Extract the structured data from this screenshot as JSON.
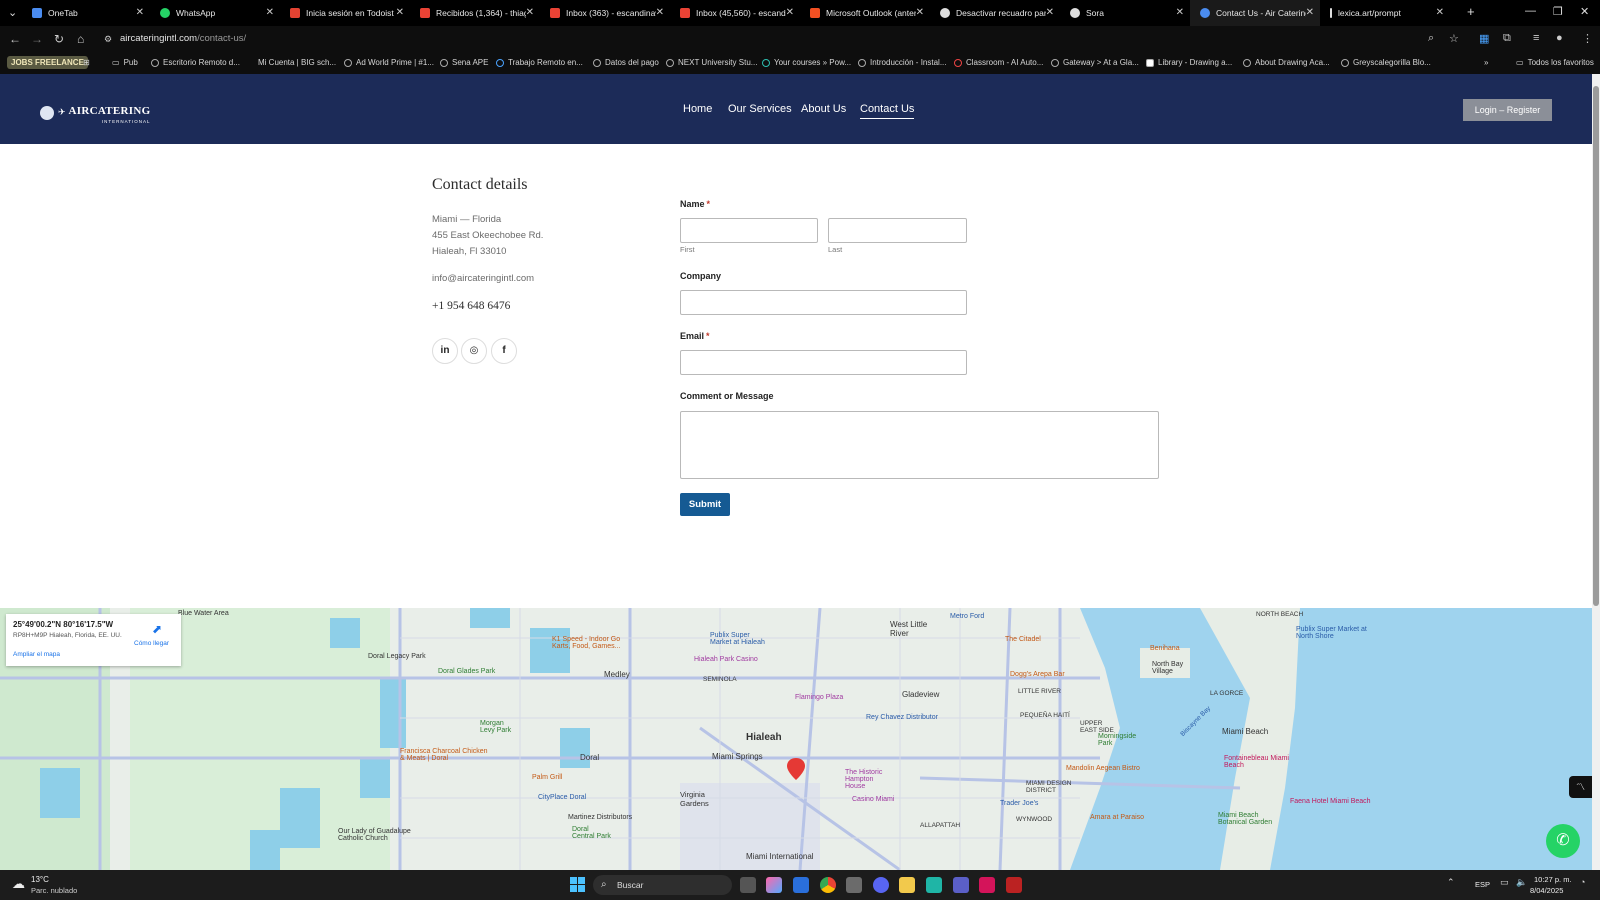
{
  "browser": {
    "tabs": [
      {
        "title": "OneTab",
        "color": "#4a8cf0"
      },
      {
        "title": "WhatsApp",
        "color": "#25d366"
      },
      {
        "title": "Inicia sesión en Todoist",
        "color": "#e44332"
      },
      {
        "title": "Recibidos (1,364) - thiago",
        "color": "#ea4335"
      },
      {
        "title": "Inbox (363) - escandinavo",
        "color": "#ea4335"
      },
      {
        "title": "Inbox (45,560) - escandin",
        "color": "#ea4335"
      },
      {
        "title": "Microsoft Outlook (anter",
        "color": "#f25022"
      },
      {
        "title": "Desactivar recuadro panta",
        "color": "#dddddd"
      },
      {
        "title": "Sora",
        "color": "#dddddd"
      },
      {
        "title": "Contact Us - Air Catering",
        "color": "#4a8cf0"
      },
      {
        "title": "lexica.art/prompt",
        "color": "#dddddd"
      }
    ],
    "url_domain": "aircateringintl.com",
    "url_path": "/contact-us/",
    "bookmarks": {
      "jobs": "JOBS FREELANCE",
      "items": [
        "Pub",
        "Escritorio Remoto d...",
        "Mi Cuenta | BIG sch...",
        "Ad World Prime | #1...",
        "Sena APE",
        "Trabajo Remoto en...",
        "Datos del pago",
        "NEXT University Stu...",
        "Your courses » Pow...",
        "Introducción - Instal...",
        "Classroom - AI Auto...",
        "Gateway > At a Gla...",
        "Library - Drawing a...",
        "About Drawing Aca...",
        "Greyscalegorilla Blo..."
      ],
      "all_favorites": "Todos los favoritos"
    }
  },
  "site": {
    "logo_text": "AIRCATERING",
    "logo_sub": "INTERNATIONAL",
    "menu": [
      "Home",
      "Our Services",
      "About Us",
      "Contact Us"
    ],
    "login": "Login – Register"
  },
  "contact": {
    "title": "Contact details",
    "address": [
      "Miami — Florida",
      "455 East Okeechobee Rd.",
      "Hialeah, Fl 33010"
    ],
    "email": "info@aircateringintl.com",
    "phone": "+1 954 648 6476",
    "social": [
      "in",
      "◎",
      "f"
    ]
  },
  "form": {
    "name_label": "Name",
    "required_mark": "*",
    "first_label": "First",
    "last_label": "Last",
    "company_label": "Company",
    "email_label": "Email",
    "message_label": "Comment or Message",
    "submit": "Submit"
  },
  "map": {
    "coords": "25°49'00.2\"N 80°16'17.5\"W",
    "plus_code": "RP8H+M9P Hialeah, Florida, EE. UU.",
    "directions": "Cómo llegar",
    "enlarge": "Ampliar el mapa",
    "labels": [
      "Doral Legacy Park",
      "Doral Glades Park",
      "K1 Speed - Indoor Go Karts, Food, Games...",
      "Publix Super Market at Hialeah",
      "Hialeah Park Casino",
      "West Little River",
      "Metro Ford",
      "The Citadel",
      "Benihana",
      "North Bay Village",
      "Publix Super Market at North Shore",
      "NORTH BEACH",
      "Medley",
      "SEMINOLA",
      "Flamingo Plaza",
      "Gladeview",
      "Dogg's Arepa Bar",
      "LITTLE RIVER",
      "LA GORCE",
      "Rey Chavez Distributor",
      "Morgan Levy Park",
      "Francisca Charcoal Chicken & Meats | Doral",
      "Hialeah",
      "Miami Springs",
      "PEQUEÑA HAITÍ",
      "UPPER EAST SIDE",
      "Morningside Park",
      "Miami Beach",
      "Doral",
      "Palm Grill",
      "The Historic Hampton House",
      "Mandolin Aegean Bistro",
      "Fontainebleau Miami Beach",
      "CityPlace Doral",
      "Virginia Gardens",
      "Casino Miami",
      "MIAMI DESIGN DISTRICT",
      "Trader Joe's",
      "Faena Hotel Miami Beach",
      "Martinez Distributors",
      "ALLAPATTAH",
      "WYNWOOD",
      "Amara at Paraiso",
      "Miami Beach Botanical Garden",
      "Doral Central Park",
      "Our Lady of Guadalupe Catholic Church",
      "Miami International",
      "Biscayne Bay",
      "Blue Water Area"
    ]
  },
  "taskbar": {
    "temp": "13°C",
    "weather": "Parc. nublado",
    "search": "Buscar",
    "lang": "ESP",
    "time": "10:27 p. m.",
    "date": "8/04/2025"
  },
  "colors": {
    "header_bg": "#1c2b58",
    "submit_bg": "#155a93",
    "required": "#c0392b"
  }
}
